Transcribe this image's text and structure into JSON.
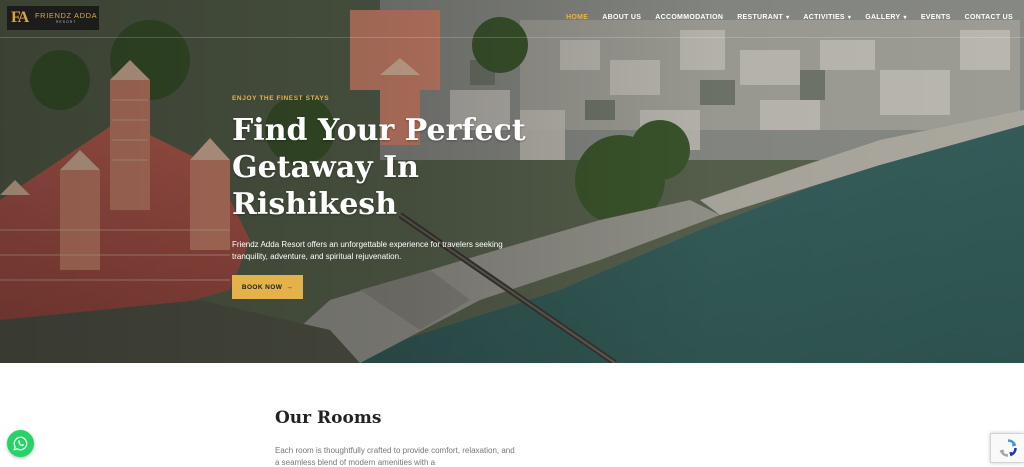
{
  "brand": {
    "mark": "FA",
    "name": "FRIENDZ ADDA",
    "sub": "RESORT"
  },
  "nav": [
    {
      "label": "HOME",
      "active": true,
      "dropdown": false
    },
    {
      "label": "ABOUT US",
      "active": false,
      "dropdown": false
    },
    {
      "label": "ACCOMMODATION",
      "active": false,
      "dropdown": false
    },
    {
      "label": "RESTURANT",
      "active": false,
      "dropdown": true
    },
    {
      "label": "ACTIVITIES",
      "active": false,
      "dropdown": true
    },
    {
      "label": "GALLERY",
      "active": false,
      "dropdown": true
    },
    {
      "label": "EVENTS",
      "active": false,
      "dropdown": false
    },
    {
      "label": "CONTACT US",
      "active": false,
      "dropdown": false
    }
  ],
  "hero": {
    "eyebrow": "ENJOY THE FINEST STAYS",
    "title_line1": "Find Your Perfect",
    "title_line2": "Getaway In",
    "title_line3": "Rishikesh",
    "description": "Friendz Adda Resort offers an unforgettable experience for travelers seeking tranquility, adventure, and spiritual rejuvenation.",
    "cta_label": "BOOK NOW",
    "cta_icon": "arrow-right-icon"
  },
  "rooms": {
    "title": "Our Rooms",
    "description": "Each room is thoughtfully crafted to provide comfort, relaxation, and a seamless blend of modern amenities with a"
  },
  "floating": {
    "whatsapp_icon": "whatsapp-icon",
    "recaptcha_icon": "recaptcha-icon"
  },
  "colors": {
    "accent": "#e3b34a",
    "nav_active": "#e6b34a",
    "whatsapp": "#25d366"
  }
}
